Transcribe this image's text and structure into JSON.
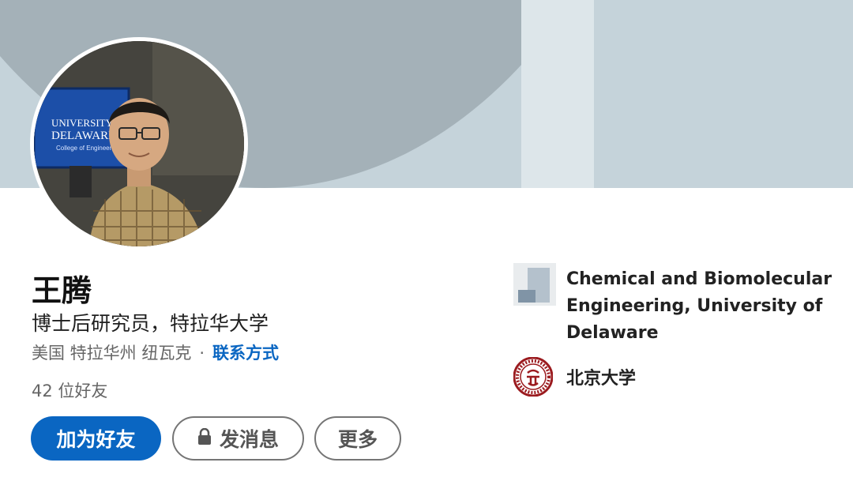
{
  "profile": {
    "name": "王腾",
    "headline": "博士后研究员，特拉华大学",
    "location": "美国 特拉华州 纽瓦克",
    "separator": "·",
    "contact_link": "联系方式",
    "connections": "42 位好友",
    "photo_sign_line1": "UNIVERSITY OF",
    "photo_sign_line2": "DELAWARE.",
    "photo_sign_line3": "College of Engineering"
  },
  "actions": {
    "connect_label": "加为好友",
    "message_label": "发消息",
    "more_label": "更多"
  },
  "sidebar": {
    "organization": "Chemical and Biomolecular Engineering, University of Delaware",
    "school": "北京大学"
  },
  "colors": {
    "accent": "#0a66c2",
    "banner": "#c5d3da",
    "banner_shape": "#a4b1b8",
    "school_seal": "#9b1b1f"
  },
  "icons": {
    "message_button_icon": "lock-icon",
    "organization_logo": "building-logo-icon",
    "school_logo": "peking-university-seal-icon"
  }
}
